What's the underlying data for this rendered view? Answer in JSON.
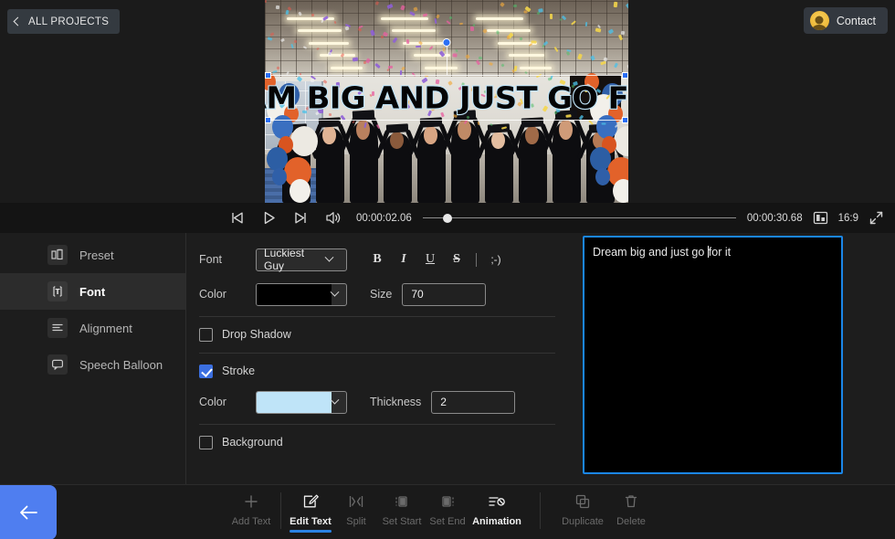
{
  "topbar": {
    "all_projects_label": "ALL PROJECTS",
    "back_chevron_icon": "chevron-left-icon",
    "contact_label": "Contact",
    "avatar_icon": "user-avatar-icon"
  },
  "preview": {
    "overlay_text": "Dream big and just go for it",
    "overlay_text_color": "#050505",
    "overlay_stroke_color": "#bfe4f8"
  },
  "transport": {
    "prev_icon": "skip-previous-icon",
    "play_icon": "play-icon",
    "next_icon": "skip-next-icon",
    "volume_icon": "volume-icon",
    "current_time": "00:00:02.06",
    "total_time": "00:00:30.68",
    "ratio_icon": "aspect-ratio-icon",
    "ratio_label": "16:9",
    "fullscreen_icon": "fullscreen-icon",
    "scrub_position_pct": 6.5
  },
  "sidebar": {
    "items": [
      {
        "label": "Preset",
        "icon": "preset-icon",
        "active": false
      },
      {
        "label": "Font",
        "icon": "font-icon",
        "active": true
      },
      {
        "label": "Alignment",
        "icon": "alignment-icon",
        "active": false
      },
      {
        "label": "Speech Balloon",
        "icon": "speech-balloon-icon",
        "active": false
      }
    ]
  },
  "panel": {
    "font_label": "Font",
    "font_value": "Luckiest Guy",
    "bold_label": "B",
    "italic_label": "I",
    "underline_label": "U",
    "strike_label": "S",
    "emoji_label": ";-)",
    "color_label": "Color",
    "color_value": "#000000",
    "size_label": "Size",
    "size_value": "70",
    "drop_shadow_label": "Drop Shadow",
    "drop_shadow_checked": false,
    "stroke_label": "Stroke",
    "stroke_checked": true,
    "stroke_color_label": "Color",
    "stroke_color_value": "#bfe4f8",
    "thickness_label": "Thickness",
    "thickness_value": "2",
    "background_label": "Background",
    "background_checked": false
  },
  "textarea": {
    "value_before_caret": "Dream big and just go ",
    "value_after_caret": "for it",
    "full_value": "Dream big and just go for it"
  },
  "bottombar": {
    "back_icon": "arrow-left-icon",
    "tools": [
      {
        "label": "Add Text",
        "icon": "plus-icon",
        "state": "dim"
      },
      {
        "label": "Edit Text",
        "icon": "edit-pencil-icon",
        "state": "on"
      },
      {
        "label": "Split",
        "icon": "split-icon",
        "state": "dim"
      },
      {
        "label": "Set Start",
        "icon": "set-start-icon",
        "state": "dim"
      },
      {
        "label": "Set End",
        "icon": "set-end-icon",
        "state": "dim"
      },
      {
        "label": "Animation",
        "icon": "animation-icon",
        "state": "on"
      },
      {
        "label": "Duplicate",
        "icon": "duplicate-icon",
        "state": "dim"
      },
      {
        "label": "Delete",
        "icon": "trash-icon",
        "state": "dim"
      }
    ]
  },
  "colors": {
    "accent_blue": "#2a82e4",
    "back_button_blue": "#4f7ef0",
    "checkbox_blue": "#3b6fe0",
    "focus_border": "#1b86e8"
  }
}
